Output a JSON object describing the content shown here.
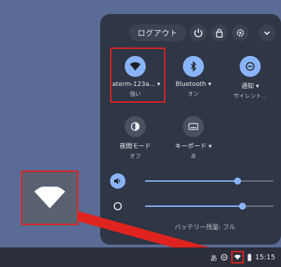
{
  "header": {
    "logout_label": "ログアウト",
    "buttons": [
      "power-icon",
      "lock-icon",
      "gear-icon",
      "chevron-down-icon"
    ]
  },
  "tiles": [
    {
      "name": "aterm-123a...",
      "has_menu": true,
      "sub": "強い",
      "icon": "wifi-icon",
      "active": true
    },
    {
      "name": "Bluetooth",
      "has_menu": true,
      "sub": "オン",
      "icon": "bluetooth-icon",
      "active": true
    },
    {
      "name": "通知",
      "has_menu": true,
      "sub": "サイレント...",
      "icon": "do-not-disturb-icon",
      "active": true
    },
    {
      "name": "夜間モード",
      "has_menu": false,
      "sub": "オフ",
      "icon": "night-light-icon",
      "active": false
    },
    {
      "name": "キーボード",
      "has_menu": true,
      "sub": "あ",
      "icon": "keyboard-icon",
      "active": false
    }
  ],
  "sliders": {
    "volume_level": 0.72,
    "brightness_level": 0.76
  },
  "footer": {
    "battery_text": "バッテリー残量: フル"
  },
  "tray": {
    "ime": "あ",
    "time": "15:15"
  },
  "colors": {
    "accent": "#8ab4f8",
    "highlight": "#e0231f",
    "panel": "#2f3645",
    "desktop": "#5a6b95"
  }
}
